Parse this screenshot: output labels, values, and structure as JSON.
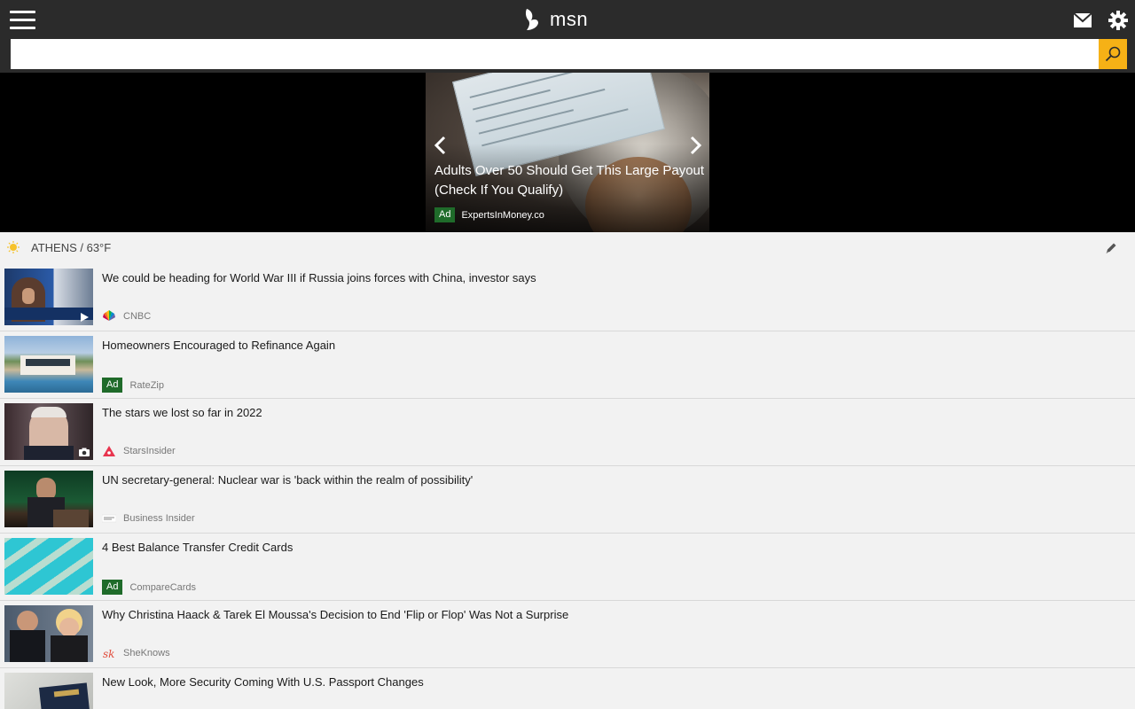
{
  "header": {
    "brand": "msn",
    "icons": [
      "menu-icon",
      "msn-butterfly-icon",
      "mail-icon",
      "gear-icon"
    ]
  },
  "search": {
    "value": "",
    "placeholder": ""
  },
  "hero": {
    "title": "Adults Over 50 Should Get This Large Payout (Check If You Qualify)",
    "ad_label": "Ad",
    "source": "ExpertsInMoney.co"
  },
  "weather": {
    "text": "ATHENS / 63°F"
  },
  "news": [
    {
      "title": "We could be heading for World War III if Russia joins forces with China, investor says",
      "source": "CNBC",
      "ad": "",
      "overlay": "play-icon"
    },
    {
      "title": "Homeowners Encouraged to Refinance Again",
      "source": "RateZip",
      "ad": "Ad",
      "overlay": ""
    },
    {
      "title": "The stars we lost so far in 2022",
      "source": "StarsInsider",
      "ad": "",
      "overlay": "camera-icon"
    },
    {
      "title": "UN secretary-general: Nuclear war is 'back within the realm of possibility'",
      "source": "Business Insider",
      "ad": "",
      "overlay": ""
    },
    {
      "title": "4 Best Balance Transfer Credit Cards",
      "source": "CompareCards",
      "ad": "Ad",
      "overlay": ""
    },
    {
      "title": "Why Christina Haack & Tarek El Moussa's Decision to End 'Flip or Flop' Was Not a Surprise",
      "source": "SheKnows",
      "ad": "",
      "overlay": ""
    },
    {
      "title": "New Look, More Security Coming With U.S. Passport Changes",
      "source": "",
      "ad": "",
      "overlay": ""
    }
  ],
  "colors": {
    "topbar": "#2b2b2b",
    "search_button": "#f6b116",
    "ad_badge": "#1f6b2a",
    "background": "#f2f2f2"
  }
}
